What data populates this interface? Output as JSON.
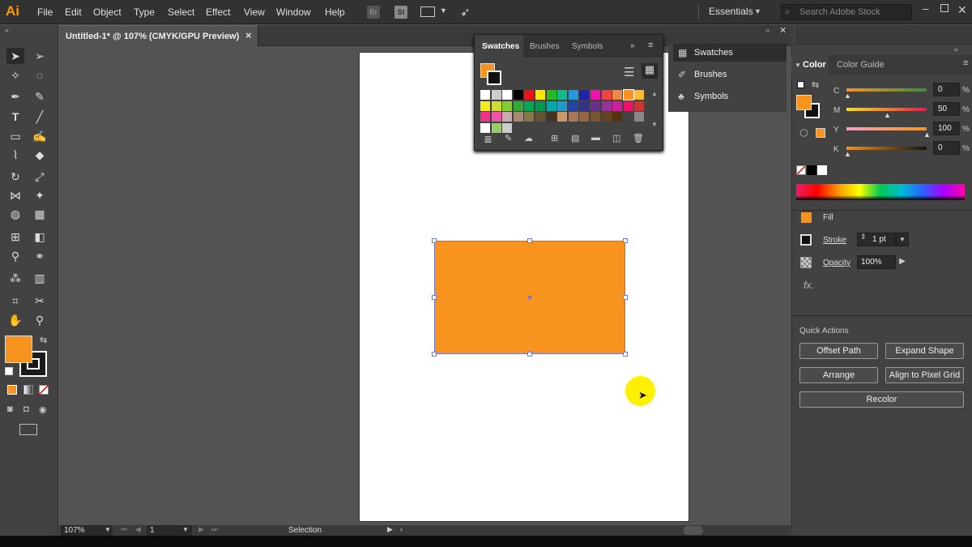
{
  "app": {
    "logo": "Ai",
    "menus": [
      "File",
      "Edit",
      "Object",
      "Type",
      "Select",
      "Effect",
      "View",
      "Window",
      "Help"
    ],
    "bridge": "Br",
    "stock": "St",
    "workspace": "Essentials",
    "search_placeholder": "Search Adobe Stock"
  },
  "document": {
    "tab_title": "Untitled-1* @ 107% (CMYK/GPU Preview)",
    "close": "×",
    "zoom": "107%",
    "page": "1",
    "status": "Selection"
  },
  "swatches_panel": {
    "tabs": [
      "Swatches",
      "Brushes",
      "Symbols"
    ],
    "active_tab": "Swatches"
  },
  "collapsed_panels": {
    "items": [
      "Swatches",
      "Brushes",
      "Symbols"
    ]
  },
  "color_panel": {
    "tabs": [
      "Color",
      "Color Guide"
    ],
    "active_tab": "Color",
    "channels": [
      {
        "label": "C",
        "value": "0"
      },
      {
        "label": "M",
        "value": "50"
      },
      {
        "label": "Y",
        "value": "100"
      },
      {
        "label": "K",
        "value": "0"
      }
    ],
    "percent": "%"
  },
  "appearance": {
    "fill_label": "Fill",
    "stroke_label": "Stroke",
    "stroke_value": "1 pt",
    "opacity_label": "Opacity",
    "opacity_value": "100%",
    "fx": "fx."
  },
  "quick_actions": {
    "title": "Quick Actions",
    "buttons": [
      "Offset Path",
      "Expand Shape",
      "Arrange",
      "Align to Pixel Grid",
      "Recolor"
    ]
  },
  "colors": {
    "fill": "#f7931e",
    "accent": "#ff9a00"
  }
}
